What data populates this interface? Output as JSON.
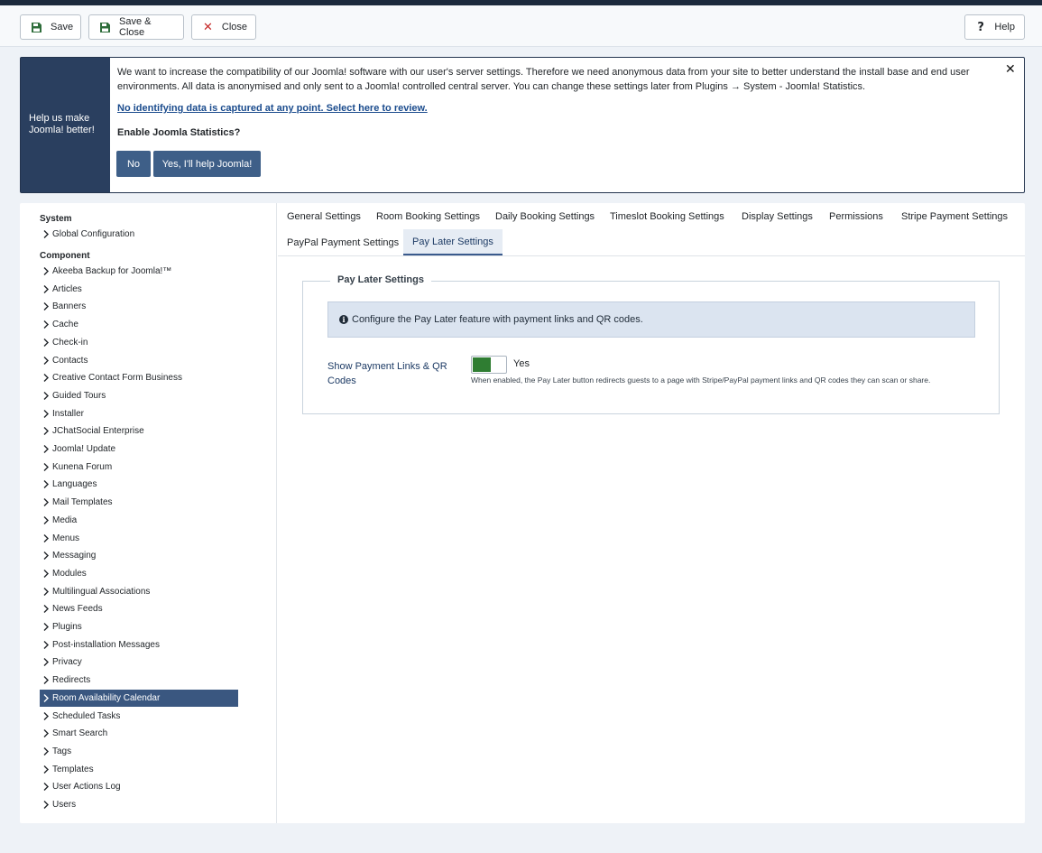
{
  "toolbar": {
    "save": "Save",
    "save_close": "Save & Close",
    "close": "Close",
    "help": "Help"
  },
  "stats": {
    "side_title_line1": "Help us make",
    "side_title_line2": "Joomla! better!",
    "body": "We want to increase the compatibility of our Joomla! software with our user's server settings. Therefore we need anonymous data from your site to better understand the install base and end user environments. All data is anonymised and only sent to a Joomla! controlled central server. You can change these settings later from Plugins → System - Joomla! Statistics.",
    "link": "No identifying data is captured at any point. Select here to review.",
    "question": "Enable Joomla Statistics?",
    "no": "No",
    "yes": "Yes, I'll help Joomla!"
  },
  "sidebar": {
    "system_label": "System",
    "system_items": [
      "Global Configuration"
    ],
    "component_label": "Component",
    "component_items": [
      "Akeeba Backup for Joomla!™",
      "Articles",
      "Banners",
      "Cache",
      "Check-in",
      "Contacts",
      "Creative Contact Form Business",
      "Guided Tours",
      "Installer",
      "JChatSocial Enterprise",
      "Joomla! Update",
      "Kunena Forum",
      "Languages",
      "Mail Templates",
      "Media",
      "Menus",
      "Messaging",
      "Modules",
      "Multilingual Associations",
      "News Feeds",
      "Plugins",
      "Post-installation Messages",
      "Privacy",
      "Redirects",
      "Room Availability Calendar",
      "Scheduled Tasks",
      "Smart Search",
      "Tags",
      "Templates",
      "User Actions Log",
      "Users"
    ],
    "active_item": "Room Availability Calendar"
  },
  "tabs": {
    "row1": [
      "General Settings",
      "Room Booking Settings",
      "Daily Booking Settings",
      "Timeslot Booking Settings",
      "Display Settings",
      "Permissions",
      "Stripe Payment Settings"
    ],
    "row2": [
      "PayPal Payment Settings",
      "Pay Later Settings"
    ],
    "active": "Pay Later Settings"
  },
  "content": {
    "legend": "Pay Later Settings",
    "alert": "Configure the Pay Later feature with payment links and QR codes.",
    "field_label": "Show Payment Links & QR Codes",
    "switch_value": "Yes",
    "switch_on": true,
    "description": "When enabled, the Pay Later button redirects guests to a page with Stripe/PayPal payment links and QR codes they can scan or share."
  },
  "colors": {
    "accent": "#3a5780",
    "toggle_on": "#2f7d32",
    "close_red": "#c52827"
  },
  "icons": {
    "save": "floppy-disk-icon",
    "close": "x-icon",
    "help": "question-icon",
    "dismiss": "close-icon",
    "info": "info-circle-icon",
    "nav": "chevron-right-icon"
  }
}
